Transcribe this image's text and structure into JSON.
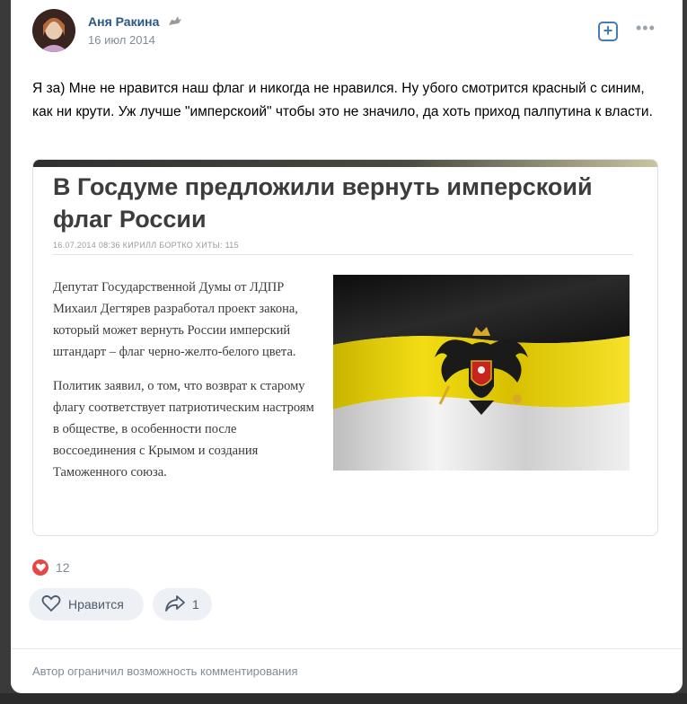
{
  "post": {
    "author": "Аня Ракина",
    "date": "16 июл 2014",
    "text": "Я за) Мне не нравится наш флаг и никогда не нравился. Ну убого смотрится красный с синим, как ни крути. Уж лучше \"имперскоий\" чтобы это не значило, да хоть приход палпутина к власти."
  },
  "article": {
    "title": "В Госдуме предложили вернуть имперскоий флаг России",
    "meta": "16.07.2014 08:36   КИРИЛЛ БОРТКО   ХИТЫ: 115",
    "paragraph1": "Депутат Государственной Думы от ЛДПР Михаил Дегтярев разработал проект закона, который может вернуть России имперский штандарт – флаг черно-желто-белого цвета.",
    "paragraph2": "Политик заявил, о том, что возврат к старому флагу соответствует патриотическим настроям в обществе, в особенности после воссоединения с Крымом и создания Таможенного союза."
  },
  "reactions": {
    "likes_count": "12",
    "like_label": "Нравится",
    "share_count": "1"
  },
  "footer": {
    "note": "Автор ограничил возможность комментирования"
  },
  "icons": {
    "add": "plus-square-icon",
    "more": "more-horizontal-icon",
    "like": "heart-icon",
    "share": "share-icon"
  },
  "colors": {
    "link": "#2a5885",
    "accent": "#447bba",
    "like_red": "#e64646",
    "muted": "#818c99"
  }
}
